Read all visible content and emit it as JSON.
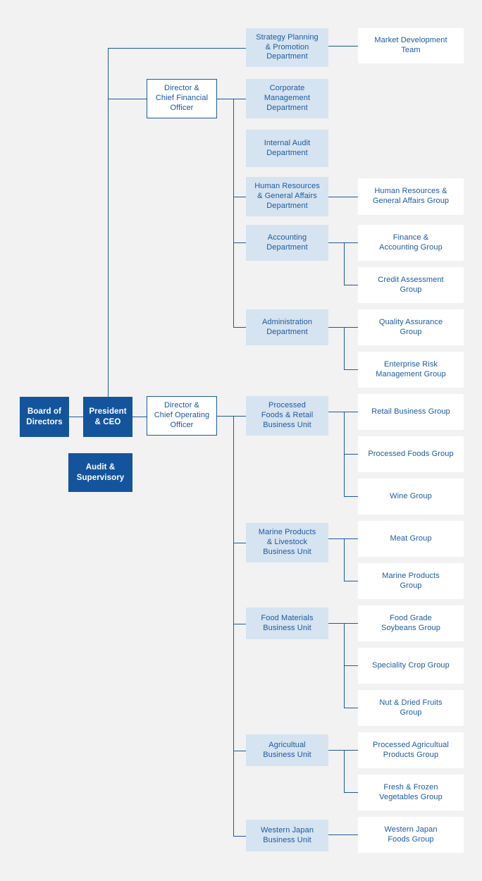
{
  "meta": {
    "title": "Organization Chart",
    "colors": {
      "background": "#f2f2f2",
      "exec_fill": "#14549c",
      "exec_text": "#ffffff",
      "line": "#1b5a9e",
      "dept_fill": "#d6e3f0",
      "group_fill": "#ffffff",
      "body_text": "#1b5a9e"
    }
  },
  "nodes": {
    "board_of_directors": "Board of\nDirectors",
    "president_ceo": "President\n& CEO",
    "audit_supervisory": "Audit &\nSupervisory",
    "director_cfo": "Director &\nChief Financial\nOfficer",
    "director_coo": "Director &\nChief Operating\nOfficer",
    "strategy_planning_dept": "Strategy Planning\n& Promotion\nDepartment",
    "corporate_management_dept": "Corporate\nManagement\nDepartment",
    "internal_audit_dept": "Internal Audit\nDepartment",
    "human_resources_dept": "Human Resources\n& General Affairs\nDepartment",
    "accounting_dept": "Accounting\nDepartment",
    "administration_dept": "Administration\nDepartment",
    "processed_foods_retail_bu": "Processed\nFoods & Retail\nBusiness Unit",
    "marine_livestock_bu": "Marine Products\n& Livestock\nBusiness Unit",
    "food_materials_bu": "Food Materials\nBusiness Unit",
    "agricultual_bu": "Agricultual\nBusiness Unit",
    "western_japan_bu": "Western Japan\nBusiness Unit",
    "market_development_team": "Market Development\nTeam",
    "hr_general_affairs_group": "Human Resources &\nGeneral Affairs Group",
    "finance_accounting_group": "Finance &\nAccounting Group",
    "credit_assessment_group": "Credit Assessment\nGroup",
    "quality_assurance_group": "Quality Assurance\nGroup",
    "enterprise_risk_group": "Enterprise Risk\nManagement Group",
    "retail_business_group": "Retail Business Group",
    "processed_foods_group": "Processed Foods Group",
    "wine_group": "Wine Group",
    "meat_group": "Meat Group",
    "marine_products_group": "Marine Products\nGroup",
    "food_grade_soybeans_group": "Food Grade\nSoybeans Group",
    "speciality_crop_group": "Speciality Crop Group",
    "nut_dried_fruits_group": "Nut & Dried Fruits\nGroup",
    "processed_agricultual_group": "Processed Agricultual\nProducts Group",
    "fresh_frozen_vegetables_group": "Fresh & Frozen\nVegetables Group",
    "western_japan_foods_group": "Western Japan\nFoods Group"
  }
}
